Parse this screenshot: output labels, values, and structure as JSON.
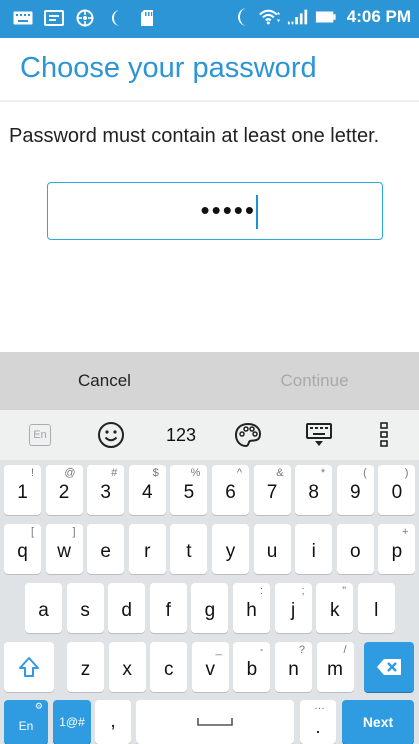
{
  "status_bar": {
    "time": "4:06 PM",
    "left_icons": [
      "keyboard-icon",
      "message-icon",
      "web-icon",
      "phone-icon",
      "sd-card-icon"
    ],
    "right_icons": [
      "moon-icon",
      "wifi-icon",
      "signal-icon",
      "battery-icon"
    ],
    "color": "#2b95d5"
  },
  "title": "Choose your password",
  "instruction": "Password must contain at least one letter.",
  "password_field": {
    "masked_value": "•••••"
  },
  "buttons": {
    "cancel": "Cancel",
    "continue": "Continue"
  },
  "keyboard": {
    "toolbar": {
      "language": "En",
      "numbers": "123"
    },
    "row1": [
      {
        "label": "1",
        "sup": "!"
      },
      {
        "label": "2",
        "sup": "@"
      },
      {
        "label": "3",
        "sup": "#"
      },
      {
        "label": "4",
        "sup": "$"
      },
      {
        "label": "5",
        "sup": "%"
      },
      {
        "label": "6",
        "sup": "^"
      },
      {
        "label": "7",
        "sup": "&"
      },
      {
        "label": "8",
        "sup": "*"
      },
      {
        "label": "9",
        "sup": "("
      },
      {
        "label": "0",
        "sup": ")"
      }
    ],
    "row2": [
      {
        "label": "q",
        "sup": "["
      },
      {
        "label": "w",
        "sup": "]"
      },
      {
        "label": "e",
        "sup": ""
      },
      {
        "label": "r",
        "sup": ""
      },
      {
        "label": "t",
        "sup": ""
      },
      {
        "label": "y",
        "sup": ""
      },
      {
        "label": "u",
        "sup": ""
      },
      {
        "label": "i",
        "sup": ""
      },
      {
        "label": "o",
        "sup": ""
      },
      {
        "label": "p",
        "sup": "+"
      }
    ],
    "row3": [
      {
        "label": "a",
        "sup": ""
      },
      {
        "label": "s",
        "sup": ""
      },
      {
        "label": "d",
        "sup": ""
      },
      {
        "label": "f",
        "sup": ""
      },
      {
        "label": "g",
        "sup": ""
      },
      {
        "label": "h",
        "sup": ":"
      },
      {
        "label": "j",
        "sup": ";"
      },
      {
        "label": "k",
        "sup": "\""
      },
      {
        "label": "l",
        "sup": ""
      }
    ],
    "row4": [
      {
        "label": "z",
        "sup": ""
      },
      {
        "label": "x",
        "sup": ""
      },
      {
        "label": "c",
        "sup": ""
      },
      {
        "label": "v",
        "sup": "_"
      },
      {
        "label": "b",
        "sup": "-"
      },
      {
        "label": "n",
        "sup": "?"
      },
      {
        "label": "m",
        "sup": "/"
      }
    ],
    "bottom": {
      "lang_key": "En",
      "symbols_key": "1@#",
      "comma": ",",
      "period": ".",
      "period_sup": "…",
      "next": "Next"
    },
    "accent_color": "#2f9be0"
  }
}
